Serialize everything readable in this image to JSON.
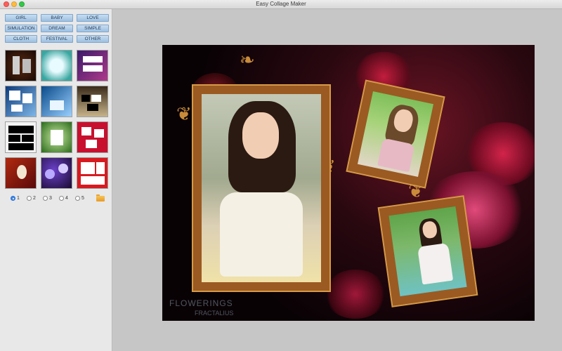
{
  "window": {
    "title": "Easy Collage Maker"
  },
  "categories": [
    "GIRL",
    "BABY",
    "LOVE",
    "SIMULATION",
    "DREAM",
    "SIMPLE",
    "CLOTH",
    "FESTIVAL",
    "OTHER"
  ],
  "templates": [
    {
      "name": "template-1"
    },
    {
      "name": "template-2"
    },
    {
      "name": "template-3"
    },
    {
      "name": "template-4"
    },
    {
      "name": "template-5"
    },
    {
      "name": "template-6"
    },
    {
      "name": "template-7"
    },
    {
      "name": "template-8"
    },
    {
      "name": "template-9"
    },
    {
      "name": "template-10"
    },
    {
      "name": "template-11"
    },
    {
      "name": "template-12"
    }
  ],
  "pages": [
    {
      "label": "1",
      "selected": true
    },
    {
      "label": "2",
      "selected": false
    },
    {
      "label": "3",
      "selected": false
    },
    {
      "label": "4",
      "selected": false
    },
    {
      "label": "5",
      "selected": false
    }
  ],
  "icons": {
    "open": "folder-icon"
  },
  "canvas": {
    "watermark_line1": "FLOWERINGS",
    "watermark_line2": "FRACTALIUS"
  },
  "colors": {
    "button_top": "#c8ddf0",
    "button_bottom": "#9dc0e2",
    "frame_wood": "#9b5a22",
    "background_dark": "#090205"
  }
}
